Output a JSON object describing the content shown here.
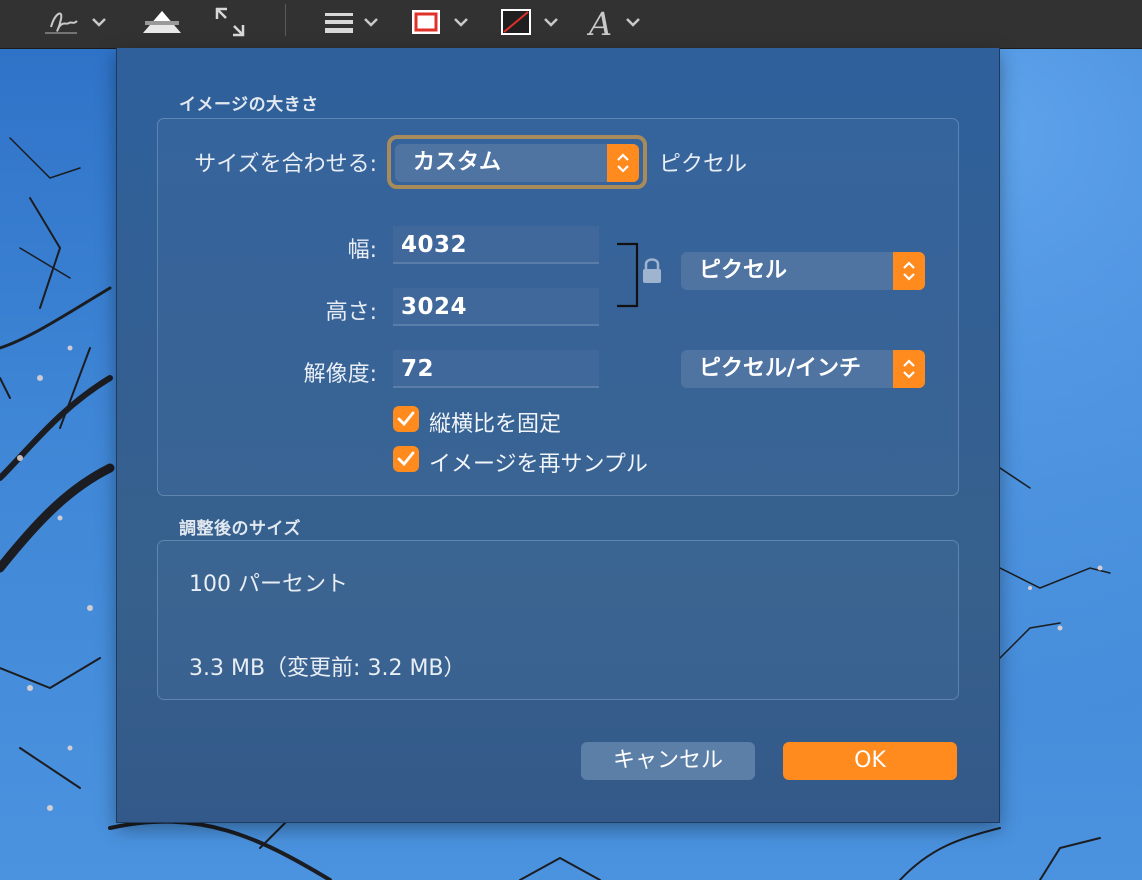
{
  "toolbar": {
    "items": [
      {
        "icon": "signature-icon"
      },
      {
        "icon": "adjust-color-icon"
      },
      {
        "icon": "adjust-size-icon"
      },
      {
        "icon": "line-style-icon"
      },
      {
        "icon": "border-color-icon"
      },
      {
        "icon": "fill-color-icon"
      },
      {
        "icon": "text-style-icon"
      }
    ],
    "colors": {
      "border_color": "#e0302a",
      "fill_slash": "#e0302a"
    }
  },
  "dialog": {
    "image_size_section": {
      "title": "イメージの大きさ",
      "fit_to_label": "サイズを合わせる:",
      "fit_to_value": "カスタム",
      "fit_to_unit": "ピクセル",
      "width_label": "幅:",
      "width_value": "4032",
      "height_label": "高さ:",
      "height_value": "3024",
      "resolution_label": "解像度:",
      "resolution_value": "72",
      "size_unit": "ピクセル",
      "resolution_unit": "ピクセル/インチ",
      "scale_proportionally": {
        "label": "縦横比を固定",
        "checked": true
      },
      "resample_image": {
        "label": "イメージを再サンプル",
        "checked": true
      }
    },
    "resulting_size_section": {
      "title": "調整後のサイズ",
      "percent": "100 パーセント",
      "file_size": "3.3 MB（変更前: 3.2 MB）"
    },
    "buttons": {
      "cancel": "キャンセル",
      "ok": "OK"
    },
    "colors": {
      "accent": "#ff8a1e",
      "sheet": "#335f92"
    }
  }
}
